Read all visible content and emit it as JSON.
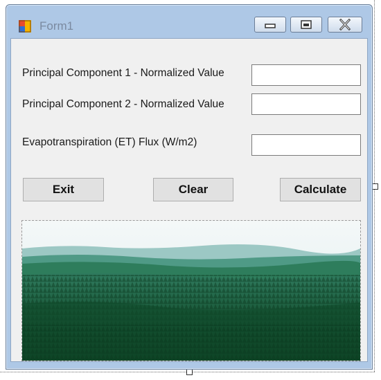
{
  "window": {
    "title": "Form1",
    "controls": {
      "minimize": "minimize-icon",
      "maximize": "maximize-icon",
      "close": "close-icon"
    }
  },
  "form": {
    "pc1_label": "Principal Component 1 - Normalized Value",
    "pc2_label": "Principal Component 2 - Normalized Value",
    "et_label": "Evapotranspiration (ET) Flux (W/m2)",
    "pc1_value": "",
    "pc2_value": "",
    "et_value": ""
  },
  "buttons": {
    "exit": "Exit",
    "clear": "Clear",
    "calculate": "Calculate"
  },
  "image": {
    "subject": "forest-landscape",
    "colors": {
      "sky": "#e8f2f6",
      "hills": "#3f8a78",
      "forest": "#0f4a2a"
    }
  }
}
